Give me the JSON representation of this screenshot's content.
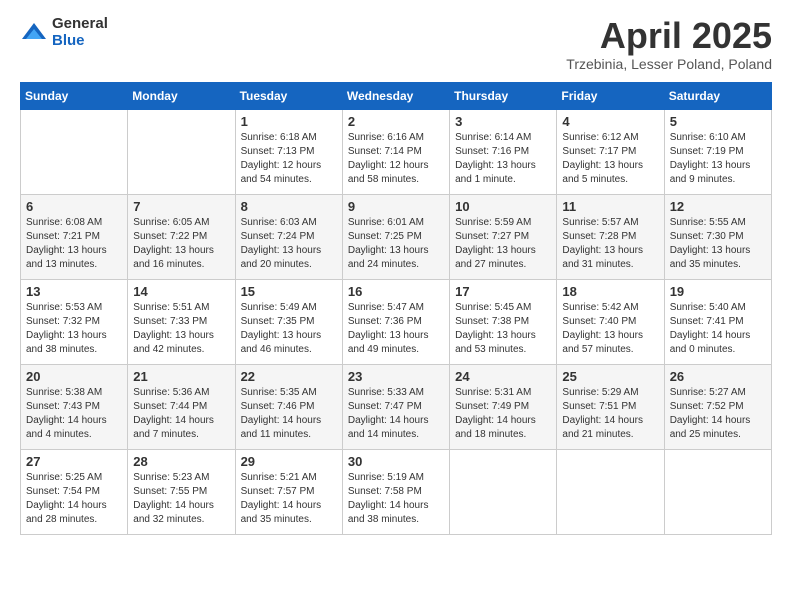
{
  "logo": {
    "general": "General",
    "blue": "Blue"
  },
  "title": "April 2025",
  "location": "Trzebinia, Lesser Poland, Poland",
  "weekdays": [
    "Sunday",
    "Monday",
    "Tuesday",
    "Wednesday",
    "Thursday",
    "Friday",
    "Saturday"
  ],
  "weeks": [
    [
      {
        "day": "",
        "info": ""
      },
      {
        "day": "",
        "info": ""
      },
      {
        "day": "1",
        "info": "Sunrise: 6:18 AM\nSunset: 7:13 PM\nDaylight: 12 hours\nand 54 minutes."
      },
      {
        "day": "2",
        "info": "Sunrise: 6:16 AM\nSunset: 7:14 PM\nDaylight: 12 hours\nand 58 minutes."
      },
      {
        "day": "3",
        "info": "Sunrise: 6:14 AM\nSunset: 7:16 PM\nDaylight: 13 hours\nand 1 minute."
      },
      {
        "day": "4",
        "info": "Sunrise: 6:12 AM\nSunset: 7:17 PM\nDaylight: 13 hours\nand 5 minutes."
      },
      {
        "day": "5",
        "info": "Sunrise: 6:10 AM\nSunset: 7:19 PM\nDaylight: 13 hours\nand 9 minutes."
      }
    ],
    [
      {
        "day": "6",
        "info": "Sunrise: 6:08 AM\nSunset: 7:21 PM\nDaylight: 13 hours\nand 13 minutes."
      },
      {
        "day": "7",
        "info": "Sunrise: 6:05 AM\nSunset: 7:22 PM\nDaylight: 13 hours\nand 16 minutes."
      },
      {
        "day": "8",
        "info": "Sunrise: 6:03 AM\nSunset: 7:24 PM\nDaylight: 13 hours\nand 20 minutes."
      },
      {
        "day": "9",
        "info": "Sunrise: 6:01 AM\nSunset: 7:25 PM\nDaylight: 13 hours\nand 24 minutes."
      },
      {
        "day": "10",
        "info": "Sunrise: 5:59 AM\nSunset: 7:27 PM\nDaylight: 13 hours\nand 27 minutes."
      },
      {
        "day": "11",
        "info": "Sunrise: 5:57 AM\nSunset: 7:28 PM\nDaylight: 13 hours\nand 31 minutes."
      },
      {
        "day": "12",
        "info": "Sunrise: 5:55 AM\nSunset: 7:30 PM\nDaylight: 13 hours\nand 35 minutes."
      }
    ],
    [
      {
        "day": "13",
        "info": "Sunrise: 5:53 AM\nSunset: 7:32 PM\nDaylight: 13 hours\nand 38 minutes."
      },
      {
        "day": "14",
        "info": "Sunrise: 5:51 AM\nSunset: 7:33 PM\nDaylight: 13 hours\nand 42 minutes."
      },
      {
        "day": "15",
        "info": "Sunrise: 5:49 AM\nSunset: 7:35 PM\nDaylight: 13 hours\nand 46 minutes."
      },
      {
        "day": "16",
        "info": "Sunrise: 5:47 AM\nSunset: 7:36 PM\nDaylight: 13 hours\nand 49 minutes."
      },
      {
        "day": "17",
        "info": "Sunrise: 5:45 AM\nSunset: 7:38 PM\nDaylight: 13 hours\nand 53 minutes."
      },
      {
        "day": "18",
        "info": "Sunrise: 5:42 AM\nSunset: 7:40 PM\nDaylight: 13 hours\nand 57 minutes."
      },
      {
        "day": "19",
        "info": "Sunrise: 5:40 AM\nSunset: 7:41 PM\nDaylight: 14 hours\nand 0 minutes."
      }
    ],
    [
      {
        "day": "20",
        "info": "Sunrise: 5:38 AM\nSunset: 7:43 PM\nDaylight: 14 hours\nand 4 minutes."
      },
      {
        "day": "21",
        "info": "Sunrise: 5:36 AM\nSunset: 7:44 PM\nDaylight: 14 hours\nand 7 minutes."
      },
      {
        "day": "22",
        "info": "Sunrise: 5:35 AM\nSunset: 7:46 PM\nDaylight: 14 hours\nand 11 minutes."
      },
      {
        "day": "23",
        "info": "Sunrise: 5:33 AM\nSunset: 7:47 PM\nDaylight: 14 hours\nand 14 minutes."
      },
      {
        "day": "24",
        "info": "Sunrise: 5:31 AM\nSunset: 7:49 PM\nDaylight: 14 hours\nand 18 minutes."
      },
      {
        "day": "25",
        "info": "Sunrise: 5:29 AM\nSunset: 7:51 PM\nDaylight: 14 hours\nand 21 minutes."
      },
      {
        "day": "26",
        "info": "Sunrise: 5:27 AM\nSunset: 7:52 PM\nDaylight: 14 hours\nand 25 minutes."
      }
    ],
    [
      {
        "day": "27",
        "info": "Sunrise: 5:25 AM\nSunset: 7:54 PM\nDaylight: 14 hours\nand 28 minutes."
      },
      {
        "day": "28",
        "info": "Sunrise: 5:23 AM\nSunset: 7:55 PM\nDaylight: 14 hours\nand 32 minutes."
      },
      {
        "day": "29",
        "info": "Sunrise: 5:21 AM\nSunset: 7:57 PM\nDaylight: 14 hours\nand 35 minutes."
      },
      {
        "day": "30",
        "info": "Sunrise: 5:19 AM\nSunset: 7:58 PM\nDaylight: 14 hours\nand 38 minutes."
      },
      {
        "day": "",
        "info": ""
      },
      {
        "day": "",
        "info": ""
      },
      {
        "day": "",
        "info": ""
      }
    ]
  ]
}
